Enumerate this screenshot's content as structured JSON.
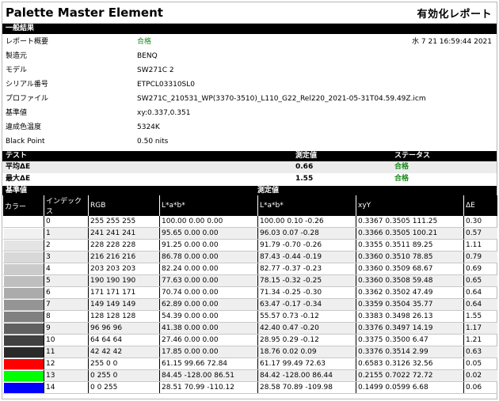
{
  "header": {
    "app_title": "Palette Master Element",
    "report_title": "有効化レポート"
  },
  "general": {
    "section_label": "一般結果",
    "rows": [
      {
        "label": "レポート概要",
        "value": "合格",
        "status": "ok"
      },
      {
        "label": "製造元",
        "value": "BENQ"
      },
      {
        "label": "モデル",
        "value": "SW271C 2"
      },
      {
        "label": "シリアル番号",
        "value": "ETPCL03310SL0"
      },
      {
        "label": "プロファイル",
        "value": "SW271C_210531_WP(3370-3510)_L110_G22_Rel220_2021-05-31T04.59.49Z.icm"
      },
      {
        "label": "基準値",
        "value": "xy:0.337,0.351"
      },
      {
        "label": "違成色温度",
        "value": "5324K"
      },
      {
        "label": "Black Point",
        "value": "0.50 nits"
      }
    ],
    "date": "水 7 21 16:59:44 2021"
  },
  "tests": {
    "headers": {
      "test": "テスト",
      "measured": "測定値",
      "status": "ステータス"
    },
    "rows": [
      {
        "name": "平均ΔE",
        "value": "0.66",
        "status": "合格"
      },
      {
        "name": "最大ΔE",
        "value": "1.55",
        "status": "合格"
      }
    ]
  },
  "table": {
    "group_reference": "基準値",
    "group_measured": "測定値",
    "columns": [
      "カラー",
      "インデックス",
      "RGB",
      "L*a*b*",
      "L*a*b*",
      "xyY",
      "ΔE"
    ],
    "rows": [
      {
        "swatch": "#ffffff",
        "index": "0",
        "rgb": "255  255  255",
        "ref_lab": "100.00  0.00  0.00",
        "meas_lab": "100.00  0.10  -0.26",
        "xyy": "0.3367  0.3505  111.25",
        "de": "0.30"
      },
      {
        "swatch": "#f1f1f1",
        "index": "1",
        "rgb": "241  241  241",
        "ref_lab": "95.65  0.00  0.00",
        "meas_lab": "96.03  0.07  -0.28",
        "xyy": "0.3366  0.3505  100.21",
        "de": "0.57"
      },
      {
        "swatch": "#e4e4e4",
        "index": "2",
        "rgb": "228  228  228",
        "ref_lab": "91.25  0.00  0.00",
        "meas_lab": "91.79  -0.70  -0.26",
        "xyy": "0.3355  0.3511  89.25",
        "de": "1.11"
      },
      {
        "swatch": "#d8d8d8",
        "index": "3",
        "rgb": "216  216  216",
        "ref_lab": "86.78  0.00  0.00",
        "meas_lab": "87.43  -0.44  -0.19",
        "xyy": "0.3360  0.3510  78.85",
        "de": "0.79"
      },
      {
        "swatch": "#cbcbcb",
        "index": "4",
        "rgb": "203  203  203",
        "ref_lab": "82.24  0.00  0.00",
        "meas_lab": "82.77  -0.37  -0.23",
        "xyy": "0.3360  0.3509  68.67",
        "de": "0.69"
      },
      {
        "swatch": "#bebebe",
        "index": "5",
        "rgb": "190  190  190",
        "ref_lab": "77.63  0.00  0.00",
        "meas_lab": "78.15  -0.32  -0.25",
        "xyy": "0.3360  0.3508  59.48",
        "de": "0.65"
      },
      {
        "swatch": "#ababab",
        "index": "6",
        "rgb": "171  171  171",
        "ref_lab": "70.74  0.00  0.00",
        "meas_lab": "71.34  -0.25  -0.30",
        "xyy": "0.3362  0.3502  47.49",
        "de": "0.64"
      },
      {
        "swatch": "#959595",
        "index": "7",
        "rgb": "149  149  149",
        "ref_lab": "62.89  0.00  0.00",
        "meas_lab": "63.47  -0.17  -0.34",
        "xyy": "0.3359  0.3504  35.77",
        "de": "0.64"
      },
      {
        "swatch": "#808080",
        "index": "8",
        "rgb": "128  128  128",
        "ref_lab": "54.39  0.00  0.00",
        "meas_lab": "55.57  0.73  -0.12",
        "xyy": "0.3383  0.3498  26.13",
        "de": "1.55"
      },
      {
        "swatch": "#606060",
        "index": "9",
        "rgb": "96  96  96",
        "ref_lab": "41.38  0.00  0.00",
        "meas_lab": "42.40  0.47  -0.20",
        "xyy": "0.3376  0.3497  14.19",
        "de": "1.17"
      },
      {
        "swatch": "#404040",
        "index": "10",
        "rgb": "64  64  64",
        "ref_lab": "27.46  0.00  0.00",
        "meas_lab": "28.95  0.29  -0.12",
        "xyy": "0.3375  0.3500  6.47",
        "de": "1.21"
      },
      {
        "swatch": "#2a2a2a",
        "index": "11",
        "rgb": "42  42  42",
        "ref_lab": "17.85  0.00  0.00",
        "meas_lab": "18.76  0.02  0.09",
        "xyy": "0.3376  0.3514  2.99",
        "de": "0.63"
      },
      {
        "swatch": "#ff0000",
        "index": "12",
        "rgb": "255  0  0",
        "ref_lab": "61.15  99.66  72.84",
        "meas_lab": "61.17  99.49  72.63",
        "xyy": "0.6583  0.3126  32.56",
        "de": "0.05"
      },
      {
        "swatch": "#00ff00",
        "index": "13",
        "rgb": "0  255  0",
        "ref_lab": "84.45  -128.00  86.51",
        "meas_lab": "84.42  -128.00  86.44",
        "xyy": "0.2155  0.7022  72.72",
        "de": "0.02"
      },
      {
        "swatch": "#0000ff",
        "index": "14",
        "rgb": "0  0  255",
        "ref_lab": "28.51  70.99  -110.12",
        "meas_lab": "28.58  70.89  -109.98",
        "xyy": "0.1499  0.0599  6.68",
        "de": "0.06"
      }
    ]
  },
  "colors": {
    "pass": "#1a8a1a",
    "header_bg": "#000000"
  }
}
